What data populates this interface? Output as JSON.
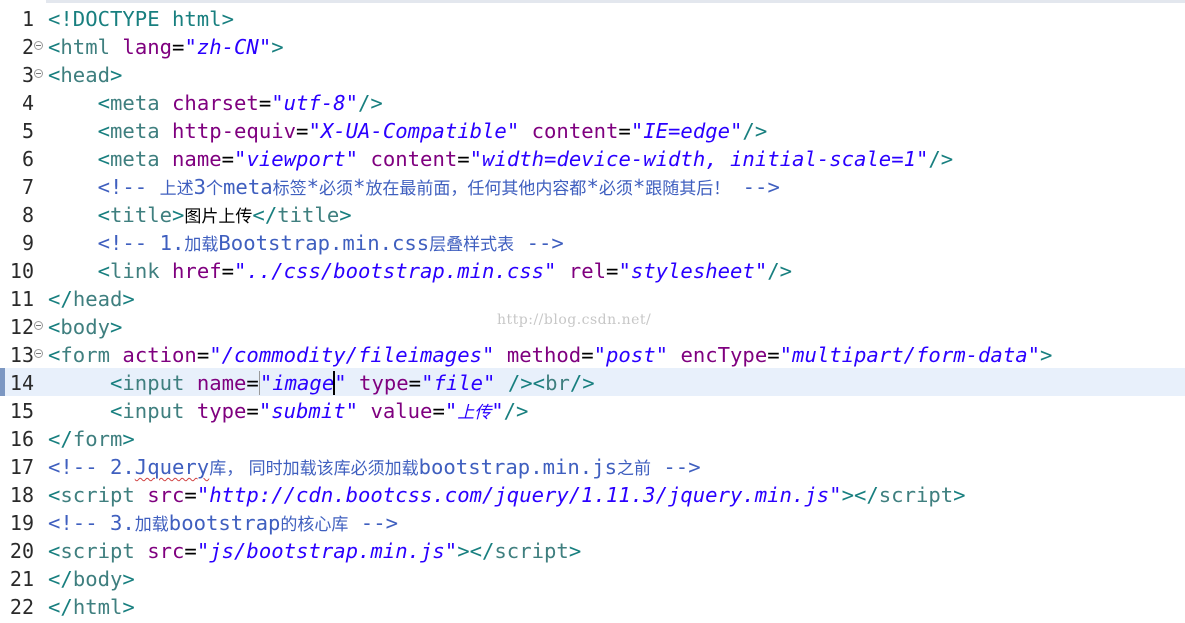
{
  "editor": {
    "watermark": "http://blog.csdn.net/",
    "current_line": 14,
    "lines": [
      {
        "n": "1",
        "fold": false
      },
      {
        "n": "2",
        "fold": true
      },
      {
        "n": "3",
        "fold": true
      },
      {
        "n": "4",
        "fold": false
      },
      {
        "n": "5",
        "fold": false
      },
      {
        "n": "6",
        "fold": false
      },
      {
        "n": "7",
        "fold": false
      },
      {
        "n": "8",
        "fold": false
      },
      {
        "n": "9",
        "fold": false
      },
      {
        "n": "10",
        "fold": false
      },
      {
        "n": "11",
        "fold": false
      },
      {
        "n": "12",
        "fold": true
      },
      {
        "n": "13",
        "fold": true
      },
      {
        "n": "14",
        "fold": false
      },
      {
        "n": "15",
        "fold": false
      },
      {
        "n": "16",
        "fold": false
      },
      {
        "n": "17",
        "fold": false
      },
      {
        "n": "18",
        "fold": false
      },
      {
        "n": "19",
        "fold": false
      },
      {
        "n": "20",
        "fold": false
      },
      {
        "n": "21",
        "fold": false
      },
      {
        "n": "22",
        "fold": false
      }
    ],
    "code": [
      [
        [
          "doc",
          "<!DOCTYPE html>"
        ]
      ],
      [
        [
          "tag",
          "<"
        ],
        [
          "el",
          "html"
        ],
        [
          "sp",
          " "
        ],
        [
          "attr",
          "lang"
        ],
        [
          "eq",
          "="
        ],
        [
          "val",
          "\"zh-CN\""
        ],
        [
          "tag",
          ">"
        ]
      ],
      [
        [
          "tag",
          "<"
        ],
        [
          "el",
          "head"
        ],
        [
          "tag",
          ">"
        ]
      ],
      [
        [
          "sp",
          "    "
        ],
        [
          "tag",
          "<"
        ],
        [
          "el",
          "meta"
        ],
        [
          "sp",
          " "
        ],
        [
          "attr",
          "charset"
        ],
        [
          "eq",
          "="
        ],
        [
          "val",
          "\"utf-8\""
        ],
        [
          "tag",
          "/>"
        ]
      ],
      [
        [
          "sp",
          "    "
        ],
        [
          "tag",
          "<"
        ],
        [
          "el",
          "meta"
        ],
        [
          "sp",
          " "
        ],
        [
          "attr",
          "http-equiv"
        ],
        [
          "eq",
          "="
        ],
        [
          "val",
          "\"X-UA-Compatible\""
        ],
        [
          "sp",
          " "
        ],
        [
          "attr",
          "content"
        ],
        [
          "eq",
          "="
        ],
        [
          "val",
          "\"IE=edge\""
        ],
        [
          "tag",
          "/>"
        ]
      ],
      [
        [
          "sp",
          "    "
        ],
        [
          "tag",
          "<"
        ],
        [
          "el",
          "meta"
        ],
        [
          "sp",
          " "
        ],
        [
          "attr",
          "name"
        ],
        [
          "eq",
          "="
        ],
        [
          "val",
          "\"viewport\""
        ],
        [
          "sp",
          " "
        ],
        [
          "attr",
          "content"
        ],
        [
          "eq",
          "="
        ],
        [
          "val",
          "\"width=device-width, initial-scale=1\""
        ],
        [
          "tag",
          "/>"
        ]
      ],
      [
        [
          "sp",
          "    "
        ],
        [
          "cmt",
          "<!-- "
        ],
        [
          "cmtcjk",
          "上述"
        ],
        [
          "cmt",
          "3"
        ],
        [
          "cmtcjk",
          "个"
        ],
        [
          "cmt",
          "meta"
        ],
        [
          "cmtcjk",
          "标签"
        ],
        [
          "cmt",
          "*"
        ],
        [
          "cmtcjk",
          "必须"
        ],
        [
          "cmt",
          "*"
        ],
        [
          "cmtcjk",
          "放在最前面，任何其他内容都"
        ],
        [
          "cmt",
          "*"
        ],
        [
          "cmtcjk",
          "必须"
        ],
        [
          "cmt",
          "*"
        ],
        [
          "cmtcjk",
          "跟随其后！"
        ],
        [
          "cmt",
          " -->"
        ]
      ],
      [
        [
          "sp",
          "    "
        ],
        [
          "tag",
          "<"
        ],
        [
          "el",
          "title"
        ],
        [
          "tag",
          ">"
        ],
        [
          "txtcjk",
          "图片上传"
        ],
        [
          "tag",
          "</"
        ],
        [
          "el",
          "title"
        ],
        [
          "tag",
          ">"
        ]
      ],
      [
        [
          "sp",
          "    "
        ],
        [
          "cmt",
          "<!-- 1."
        ],
        [
          "cmtcjk",
          "加载"
        ],
        [
          "cmt",
          "Bootstrap.min.css"
        ],
        [
          "cmtcjk",
          "层叠样式表"
        ],
        [
          "cmt",
          " -->"
        ]
      ],
      [
        [
          "sp",
          "    "
        ],
        [
          "tag",
          "<"
        ],
        [
          "el",
          "link"
        ],
        [
          "sp",
          " "
        ],
        [
          "attr",
          "href"
        ],
        [
          "eq",
          "="
        ],
        [
          "val",
          "\"../css/bootstrap.min.css\""
        ],
        [
          "sp",
          " "
        ],
        [
          "attr",
          "rel"
        ],
        [
          "eq",
          "="
        ],
        [
          "val",
          "\"stylesheet\""
        ],
        [
          "tag",
          "/>"
        ]
      ],
      [
        [
          "tag",
          "</"
        ],
        [
          "el",
          "head"
        ],
        [
          "tag",
          ">"
        ]
      ],
      [
        [
          "tag",
          "<"
        ],
        [
          "el",
          "body"
        ],
        [
          "tag",
          ">"
        ]
      ],
      [
        [
          "tag",
          "<"
        ],
        [
          "el",
          "form"
        ],
        [
          "sp",
          " "
        ],
        [
          "attr",
          "action"
        ],
        [
          "eq",
          "="
        ],
        [
          "val",
          "\"/commodity/fileimages\""
        ],
        [
          "sp",
          " "
        ],
        [
          "attr",
          "method"
        ],
        [
          "eq",
          "="
        ],
        [
          "val",
          "\"post\""
        ],
        [
          "sp",
          " "
        ],
        [
          "attr",
          "encType"
        ],
        [
          "eq",
          "="
        ],
        [
          "val",
          "\"multipart/form-data\""
        ],
        [
          "tag",
          ">"
        ]
      ],
      [
        [
          "sp",
          "     "
        ],
        [
          "tag",
          "<"
        ],
        [
          "el",
          "input"
        ],
        [
          "sp",
          " "
        ],
        [
          "attr",
          "name"
        ],
        [
          "eq",
          "="
        ],
        [
          "valsel",
          "\"image"
        ],
        [
          "caret",
          ""
        ],
        [
          "val",
          "\""
        ],
        [
          "sp",
          " "
        ],
        [
          "attr",
          "type"
        ],
        [
          "eq",
          "="
        ],
        [
          "val",
          "\"file\""
        ],
        [
          "sp",
          " "
        ],
        [
          "tag",
          "/><"
        ],
        [
          "el",
          "br"
        ],
        [
          "tag",
          "/>"
        ]
      ],
      [
        [
          "sp",
          "     "
        ],
        [
          "tag",
          "<"
        ],
        [
          "el",
          "input"
        ],
        [
          "sp",
          " "
        ],
        [
          "attr",
          "type"
        ],
        [
          "eq",
          "="
        ],
        [
          "val",
          "\"submit\""
        ],
        [
          "sp",
          " "
        ],
        [
          "attr",
          "value"
        ],
        [
          "eq",
          "="
        ],
        [
          "val",
          "\""
        ],
        [
          "valcjk",
          "上传"
        ],
        [
          "val",
          "\""
        ],
        [
          "tag",
          "/>"
        ]
      ],
      [
        [
          "tag",
          "</"
        ],
        [
          "el",
          "form"
        ],
        [
          "tag",
          ">"
        ]
      ],
      [
        [
          "cmt",
          "<!-- 2."
        ],
        [
          "cmtsq",
          "Jquery"
        ],
        [
          "cmtcjk",
          "库， 同时加载该库必须加载"
        ],
        [
          "cmt",
          "bootstrap.min.js"
        ],
        [
          "cmtcjk",
          "之前"
        ],
        [
          "cmt",
          " -->"
        ]
      ],
      [
        [
          "tag",
          "<"
        ],
        [
          "el",
          "script"
        ],
        [
          "sp",
          " "
        ],
        [
          "attr",
          "src"
        ],
        [
          "eq",
          "="
        ],
        [
          "val",
          "\"http://cdn.bootcss.com/jquery/1.11.3/jquery.min.js\""
        ],
        [
          "tag",
          "></"
        ],
        [
          "el",
          "script"
        ],
        [
          "tag",
          ">"
        ]
      ],
      [
        [
          "cmt",
          "<!-- 3."
        ],
        [
          "cmtcjk",
          "加载"
        ],
        [
          "cmt",
          "bootstrap"
        ],
        [
          "cmtcjk",
          "的核心库"
        ],
        [
          "cmt",
          " -->"
        ]
      ],
      [
        [
          "tag",
          "<"
        ],
        [
          "el",
          "script"
        ],
        [
          "sp",
          " "
        ],
        [
          "attr",
          "src"
        ],
        [
          "eq",
          "="
        ],
        [
          "val",
          "\"js/bootstrap.min.js\""
        ],
        [
          "tag",
          "></"
        ],
        [
          "el",
          "script"
        ],
        [
          "tag",
          ">"
        ]
      ],
      [
        [
          "tag",
          "</"
        ],
        [
          "el",
          "body"
        ],
        [
          "tag",
          ">"
        ]
      ],
      [
        [
          "tag",
          "</"
        ],
        [
          "el",
          "html"
        ],
        [
          "tag",
          ">"
        ]
      ]
    ]
  }
}
